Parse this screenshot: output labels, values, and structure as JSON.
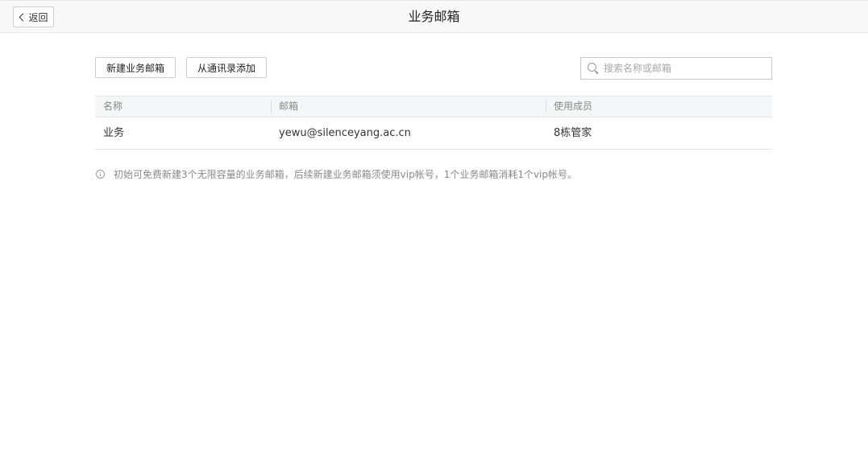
{
  "header": {
    "back_label": "返回",
    "title": "业务邮箱"
  },
  "toolbar": {
    "new_label": "新建业务邮箱",
    "contacts_label": "从通讯录添加"
  },
  "search": {
    "placeholder": "搜索名称或邮箱",
    "value": ""
  },
  "table": {
    "columns": [
      "名称",
      "邮箱",
      "使用成员"
    ],
    "rows": [
      {
        "name": "业务",
        "email": "yewu@silenceyang.ac.cn",
        "members": "8栋管家"
      }
    ]
  },
  "notice": {
    "text": "初始可免费新建3个无限容量的业务邮箱，后续新建业务邮箱须使用vip帐号，1个业务邮箱消耗1个vip帐号。"
  }
}
